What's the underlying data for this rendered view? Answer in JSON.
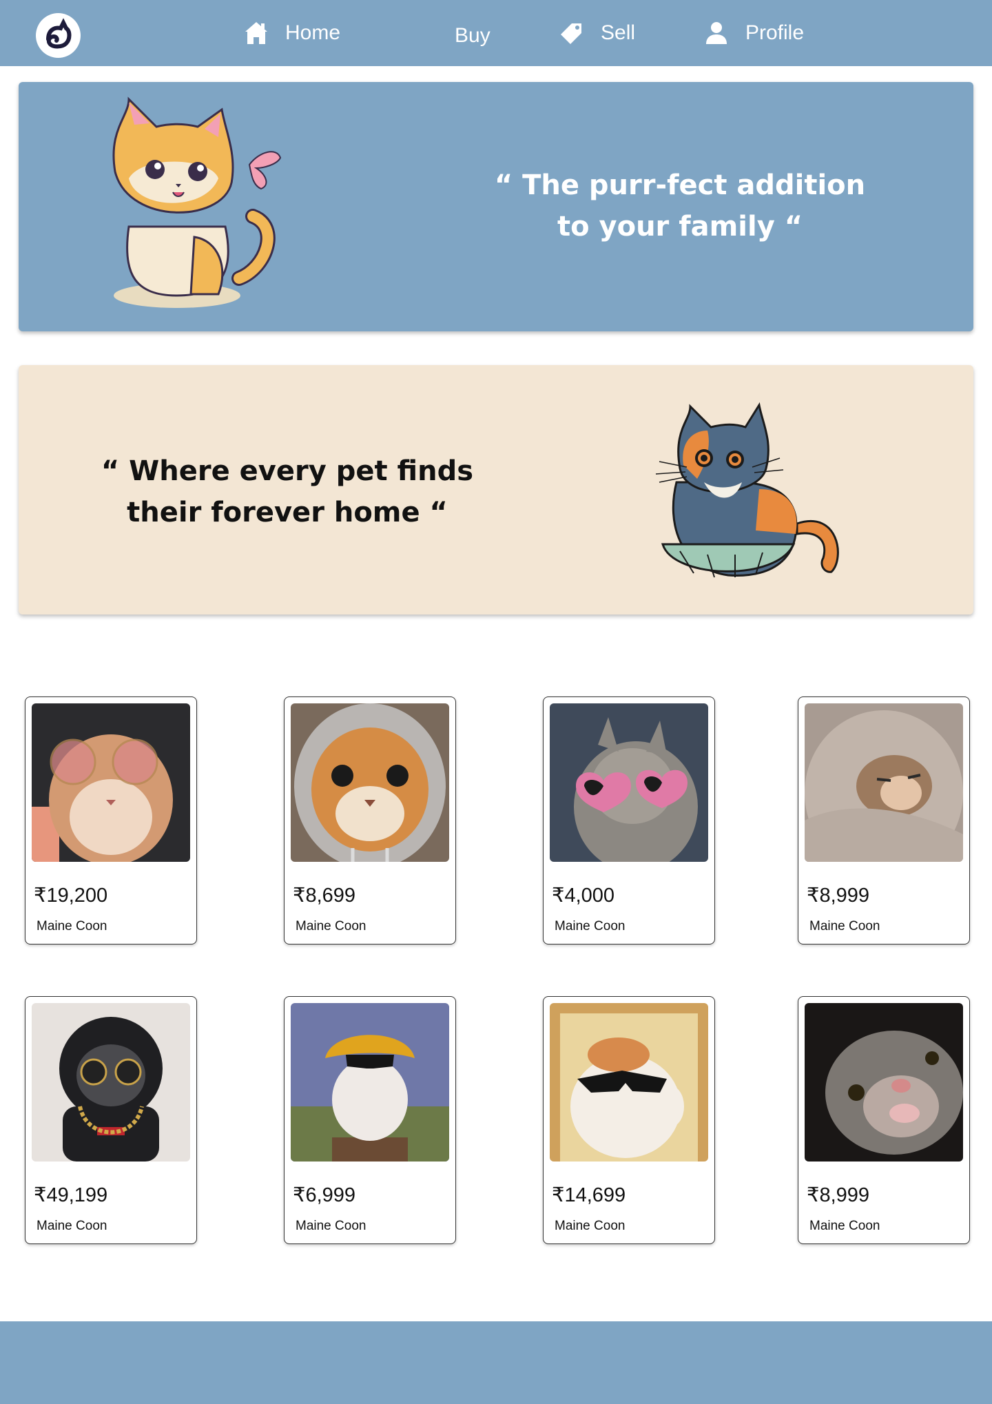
{
  "nav": {
    "home_label": "Home",
    "buy_label": "Buy",
    "sell_label": "Sell",
    "profile_label": "Profile"
  },
  "banners": {
    "top_quote_line1": "“ The purr-fect addition",
    "top_quote_line2": "to your family “",
    "second_quote_line1": "“  Where every pet finds",
    "second_quote_line2": "their forever home “"
  },
  "listings": [
    {
      "price": "₹19,200",
      "breed": "Maine Coon"
    },
    {
      "price": "₹8,699",
      "breed": "Maine Coon"
    },
    {
      "price": "₹4,000",
      "breed": "Maine Coon"
    },
    {
      "price": "₹8,999",
      "breed": "Maine Coon"
    },
    {
      "price": "₹49,199",
      "breed": "Maine Coon"
    },
    {
      "price": "₹6,999",
      "breed": "Maine Coon"
    },
    {
      "price": "₹14,699",
      "breed": "Maine Coon"
    },
    {
      "price": "₹8,999",
      "breed": "Maine Coon"
    }
  ],
  "colors": {
    "nav_bg": "#7fa5c4",
    "banner_blue": "#7fa5c4",
    "banner_cream": "#f3e6d4",
    "footer_bg": "#7fa5c4"
  },
  "icons": {
    "logo": "cat-logo-icon",
    "home": "home-icon",
    "sell": "tag-icon",
    "profile": "user-icon"
  }
}
